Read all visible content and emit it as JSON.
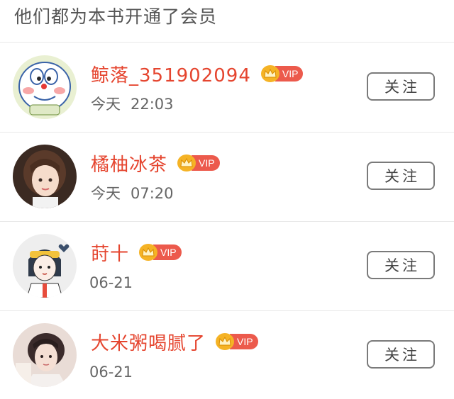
{
  "header": {
    "title": "他们都为本书开通了会员"
  },
  "vip_label": "VIP",
  "follow_label": "关注",
  "colors": {
    "name": "#e5452f",
    "vip_badge": "#ec5a4c",
    "crown": "#f5b325"
  },
  "members": [
    {
      "name": "鲸落_351902094",
      "date_prefix": "今天",
      "time": "22:03",
      "avatar_icon": "cartoon-cat-avatar-icon"
    },
    {
      "name": "橘柚冰茶",
      "date_prefix": "今天",
      "time": "07:20",
      "avatar_icon": "girl-photo-avatar-icon"
    },
    {
      "name": "莳十",
      "date_prefix": "",
      "time": "06-21",
      "avatar_icon": "illustrated-girl-avatar-icon"
    },
    {
      "name": "大米粥喝腻了",
      "date_prefix": "",
      "time": "06-21",
      "avatar_icon": "boy-photo-avatar-icon"
    }
  ]
}
